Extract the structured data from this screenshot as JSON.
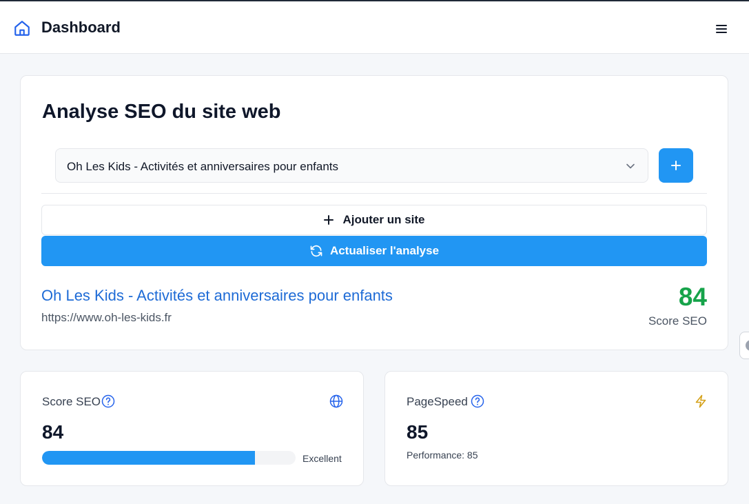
{
  "header": {
    "title": "Dashboard",
    "home_icon": "home-icon",
    "menu_icon": "hamburger-menu-icon"
  },
  "seo_analysis": {
    "title": "Analyse SEO du site web",
    "site_select": {
      "selected": "Oh Les Kids - Activités et anniversaires pour enfants"
    },
    "add_site_label": "Ajouter un site",
    "refresh_label": "Actualiser l'analyse",
    "site": {
      "name": "Oh Les Kids - Activités et anniversaires pour enfants",
      "url": "https://www.oh-les-kids.fr"
    },
    "score": {
      "value": "84",
      "label": "Score SEO"
    }
  },
  "cards": {
    "seo": {
      "label": "Score SEO",
      "value": "84",
      "progress_percent": 84,
      "rating": "Excellent",
      "icon": "globe-icon"
    },
    "pagespeed": {
      "label": "PageSpeed",
      "value": "85",
      "performance_text": "Performance: 85",
      "icon": "lightning-icon"
    }
  },
  "colors": {
    "accent": "#2196f3",
    "link": "#1e6bd6",
    "score_green": "#16a34a",
    "lightning": "#d4a017"
  }
}
